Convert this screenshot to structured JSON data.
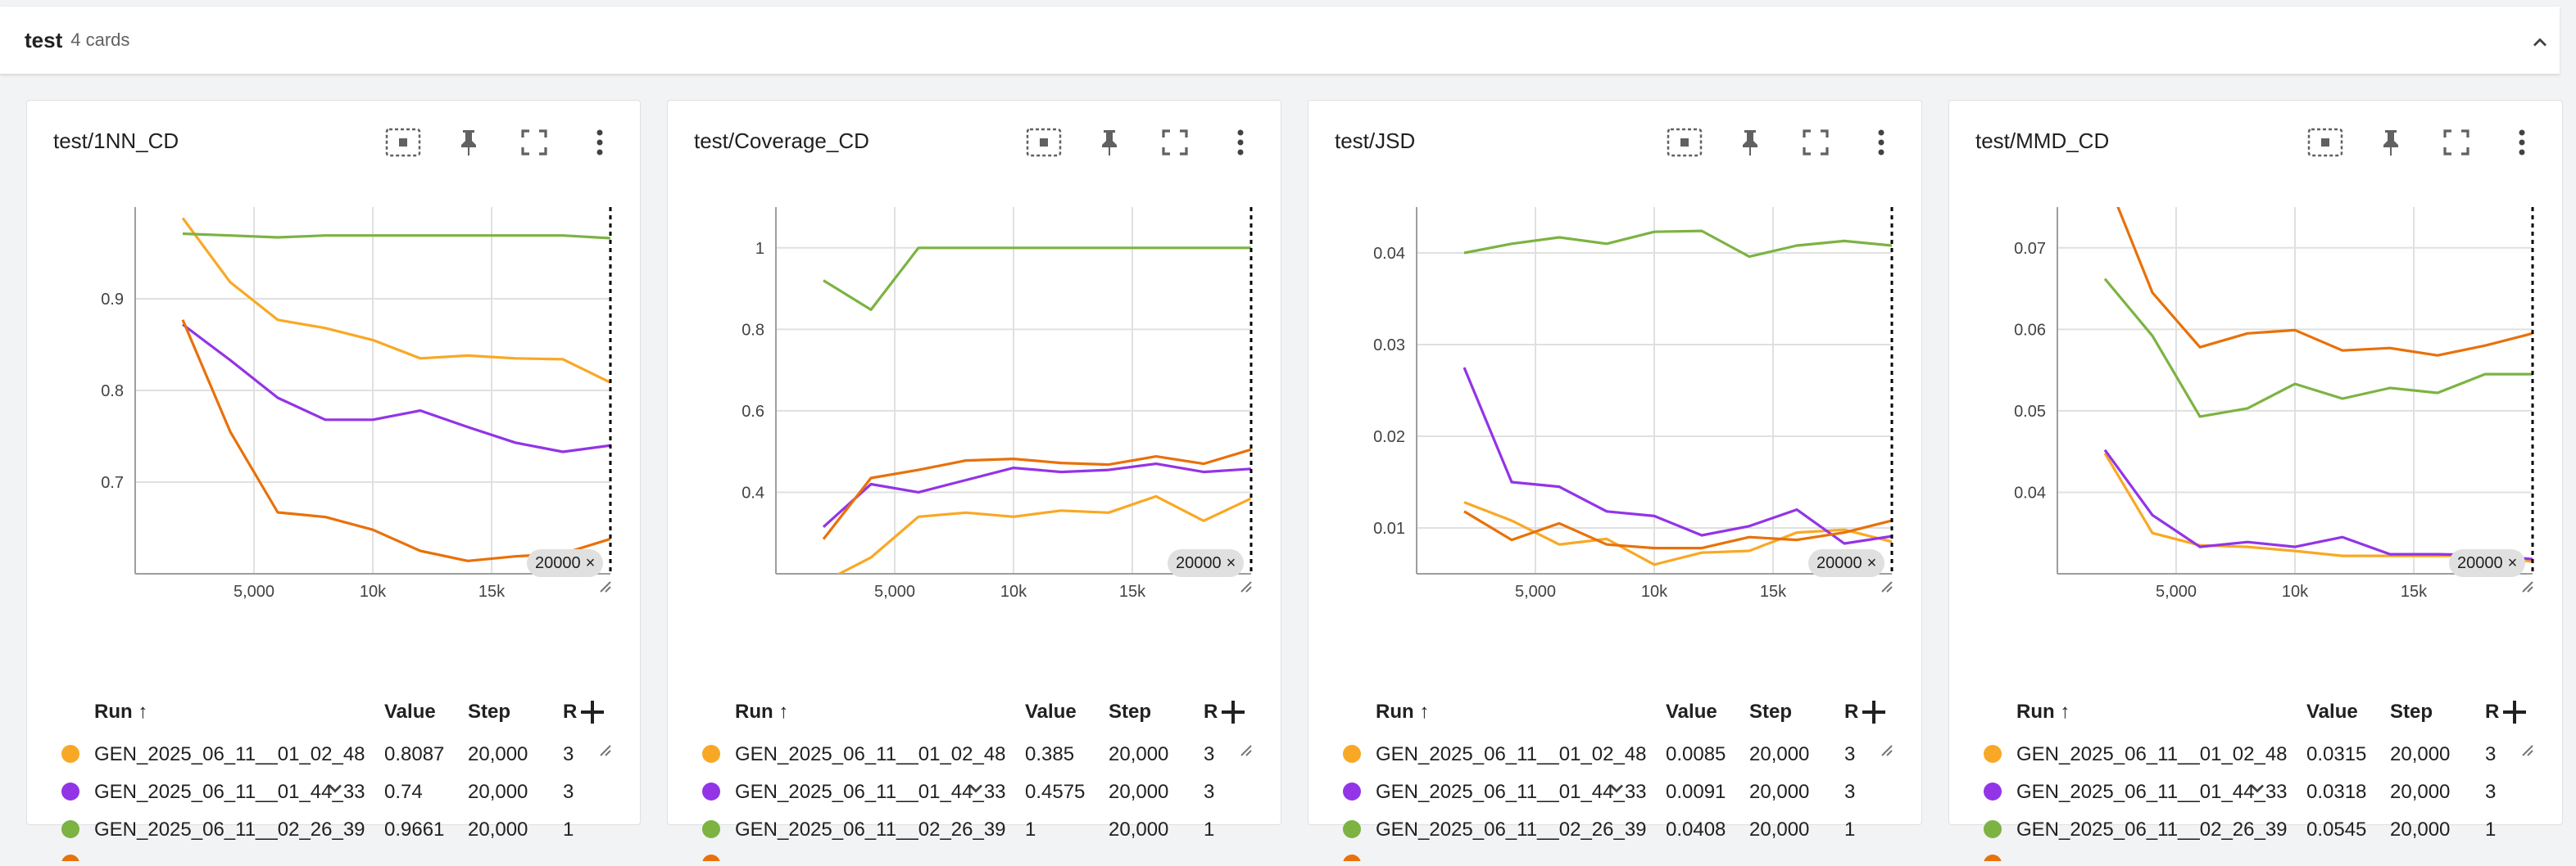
{
  "group": {
    "name": "test",
    "count": "4 cards"
  },
  "colors": {
    "orange_light": "#f9a825",
    "purple": "#9334e6",
    "green": "#7cb342",
    "orange_dark": "#e8710a"
  },
  "icons": {
    "fit": "fit-domain-icon",
    "pin": "pin-icon",
    "fullscreen": "fullscreen-icon",
    "more": "more-vert-icon",
    "collapse": "chevron-up-icon",
    "expand": "chevron-down-icon",
    "add": "add-icon"
  },
  "table_headers": {
    "run": "Run ↑",
    "value": "Value",
    "step": "Step",
    "relative": "R"
  },
  "step_chip": "20000",
  "x_ticks": [
    "5,000",
    "10k",
    "15k"
  ],
  "cards": [
    {
      "title": "test/1NN_CD",
      "chart_data": {
        "type": "line",
        "title": "test/1NN_CD",
        "x": [
          2000,
          4000,
          6000,
          8000,
          10000,
          12000,
          14000,
          16000,
          18000,
          20000
        ],
        "ylim": [
          0.6,
          1.0
        ],
        "yticks": [
          "0.9",
          "0.8",
          "0.7"
        ],
        "ytick_values": [
          0.9,
          0.8,
          0.7
        ],
        "series": [
          {
            "name": "GEN_2025_06_11__01_02_48",
            "color": "#f9a825",
            "values": [
              0.988,
              0.918,
              0.877,
              0.868,
              0.855,
              0.835,
              0.838,
              0.835,
              0.834,
              0.8087
            ]
          },
          {
            "name": "GEN_2025_06_11__01_44_33",
            "color": "#9334e6",
            "values": [
              0.872,
              0.833,
              0.792,
              0.768,
              0.768,
              0.778,
              0.76,
              0.743,
              0.733,
              0.74
            ]
          },
          {
            "name": "GEN_2025_06_11__02_26_39",
            "color": "#7cb342",
            "values": [
              0.971,
              0.969,
              0.967,
              0.969,
              0.969,
              0.969,
              0.969,
              0.969,
              0.969,
              0.9661
            ]
          },
          {
            "color": "#e8710a",
            "values": [
              0.877,
              0.755,
              0.667,
              0.662,
              0.648,
              0.625,
              0.614,
              0.619,
              0.622,
              0.638
            ]
          }
        ]
      },
      "rows": [
        {
          "run": "GEN_2025_06_11__01_02_48",
          "value": "0.8087",
          "step": "20,000",
          "relative": "3"
        },
        {
          "run": "GEN_2025_06_11__01_44_33",
          "value": "0.74",
          "step": "20,000",
          "relative": "3"
        },
        {
          "run": "GEN_2025_06_11__02_26_39",
          "value": "0.9661",
          "step": "20,000",
          "relative": "1"
        }
      ]
    },
    {
      "title": "test/Coverage_CD",
      "chart_data": {
        "type": "line",
        "title": "test/Coverage_CD",
        "x": [
          2000,
          4000,
          6000,
          8000,
          10000,
          12000,
          14000,
          16000,
          18000,
          20000
        ],
        "ylim": [
          0.2,
          1.1
        ],
        "yticks": [
          "1",
          "0.8",
          "0.6",
          "0.4"
        ],
        "ytick_values": [
          1.0,
          0.8,
          0.6,
          0.4
        ],
        "series": [
          {
            "name": "GEN_2025_06_11__01_02_48",
            "color": "#f9a825",
            "values": [
              0.18,
              0.24,
              0.34,
              0.35,
              0.34,
              0.355,
              0.35,
              0.39,
              0.33,
              0.385
            ]
          },
          {
            "name": "GEN_2025_06_11__01_44_33",
            "color": "#9334e6",
            "values": [
              0.315,
              0.42,
              0.4,
              0.43,
              0.46,
              0.45,
              0.455,
              0.47,
              0.45,
              0.4575
            ]
          },
          {
            "name": "GEN_2025_06_11__02_26_39",
            "color": "#7cb342",
            "values": [
              0.92,
              0.848,
              1.0,
              1.0,
              1.0,
              1.0,
              1.0,
              1.0,
              1.0,
              1.0
            ]
          },
          {
            "color": "#e8710a",
            "values": [
              0.285,
              0.435,
              0.455,
              0.478,
              0.482,
              0.472,
              0.468,
              0.488,
              0.47,
              0.505
            ]
          }
        ]
      },
      "rows": [
        {
          "run": "GEN_2025_06_11__01_02_48",
          "value": "0.385",
          "step": "20,000",
          "relative": "3"
        },
        {
          "run": "GEN_2025_06_11__01_44_33",
          "value": "0.4575",
          "step": "20,000",
          "relative": "3"
        },
        {
          "run": "GEN_2025_06_11__02_26_39",
          "value": "1",
          "step": "20,000",
          "relative": "1"
        }
      ]
    },
    {
      "title": "test/JSD",
      "chart_data": {
        "type": "line",
        "title": "test/JSD",
        "x": [
          2000,
          4000,
          6000,
          8000,
          10000,
          12000,
          14000,
          16000,
          18000,
          20000
        ],
        "ylim": [
          0.005,
          0.045
        ],
        "yticks": [
          "0.04",
          "0.03",
          "0.02",
          "0.01"
        ],
        "ytick_values": [
          0.04,
          0.03,
          0.02,
          0.01
        ],
        "series": [
          {
            "name": "GEN_2025_06_11__01_02_48",
            "color": "#f9a825",
            "values": [
              0.0128,
              0.0108,
              0.0082,
              0.0088,
              0.006,
              0.0073,
              0.0075,
              0.0095,
              0.0098,
              0.0085
            ]
          },
          {
            "name": "GEN_2025_06_11__01_44_33",
            "color": "#9334e6",
            "values": [
              0.0275,
              0.015,
              0.0145,
              0.0118,
              0.0113,
              0.0092,
              0.0102,
              0.012,
              0.0083,
              0.0091
            ]
          },
          {
            "name": "GEN_2025_06_11__02_26_39",
            "color": "#7cb342",
            "values": [
              0.04,
              0.041,
              0.0417,
              0.041,
              0.0423,
              0.0424,
              0.0396,
              0.0408,
              0.0413,
              0.0408
            ]
          },
          {
            "color": "#e8710a",
            "values": [
              0.0118,
              0.0087,
              0.0105,
              0.0082,
              0.0078,
              0.0078,
              0.009,
              0.0087,
              0.0095,
              0.0108
            ]
          }
        ]
      },
      "rows": [
        {
          "run": "GEN_2025_06_11__01_02_48",
          "value": "0.0085",
          "step": "20,000",
          "relative": "3"
        },
        {
          "run": "GEN_2025_06_11__01_44_33",
          "value": "0.0091",
          "step": "20,000",
          "relative": "3"
        },
        {
          "run": "GEN_2025_06_11__02_26_39",
          "value": "0.0408",
          "step": "20,000",
          "relative": "1"
        }
      ]
    },
    {
      "title": "test/MMD_CD",
      "chart_data": {
        "type": "line",
        "title": "test/MMD_CD",
        "x": [
          2000,
          4000,
          6000,
          8000,
          10000,
          12000,
          14000,
          16000,
          18000,
          20000
        ],
        "ylim": [
          0.03,
          0.075
        ],
        "yticks": [
          "0.07",
          "0.06",
          "0.05",
          "0.04"
        ],
        "ytick_values": [
          0.07,
          0.06,
          0.05,
          0.04
        ],
        "series": [
          {
            "name": "GEN_2025_06_11__01_02_48",
            "color": "#f9a825",
            "values": [
              0.0448,
              0.035,
              0.0335,
              0.0333,
              0.0328,
              0.0322,
              0.0322,
              0.0322,
              0.0322,
              0.0315
            ]
          },
          {
            "name": "GEN_2025_06_11__01_44_33",
            "color": "#9334e6",
            "values": [
              0.0452,
              0.0372,
              0.0333,
              0.0339,
              0.0333,
              0.0345,
              0.0324,
              0.0324,
              0.0323,
              0.0318
            ]
          },
          {
            "name": "GEN_2025_06_11__02_26_39",
            "color": "#7cb342",
            "values": [
              0.0662,
              0.0592,
              0.0493,
              0.0503,
              0.0533,
              0.0515,
              0.0528,
              0.0522,
              0.0545,
              0.0545
            ]
          },
          {
            "color": "#e8710a",
            "values": [
              0.079,
              0.0645,
              0.0578,
              0.0595,
              0.0599,
              0.0574,
              0.0577,
              0.0568,
              0.058,
              0.0595
            ]
          }
        ]
      },
      "rows": [
        {
          "run": "GEN_2025_06_11__01_02_48",
          "value": "0.0315",
          "step": "20,000",
          "relative": "3"
        },
        {
          "run": "GEN_2025_06_11__01_44_33",
          "value": "0.0318",
          "step": "20,000",
          "relative": "3"
        },
        {
          "run": "GEN_2025_06_11__02_26_39",
          "value": "0.0545",
          "step": "20,000",
          "relative": "1"
        }
      ]
    }
  ]
}
